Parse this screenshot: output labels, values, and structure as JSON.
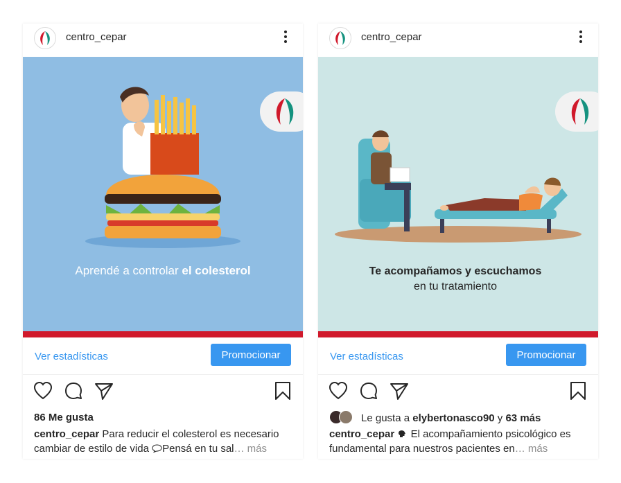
{
  "colors": {
    "accent_blue": "#3897f0",
    "brand_red": "#d0192b",
    "brand_teal": "#15927f",
    "text": "#262626",
    "muted": "#8e8e8e",
    "left_bg": "#8fbde3",
    "right_bg": "#cde6e6"
  },
  "posts": [
    {
      "username": "centro_cepar",
      "menu_icon": "more-vertical-icon",
      "image_text_line1_normal": "Aprendé a controlar ",
      "image_text_line1_bold": "el colesterol",
      "stats_link": "Ver estadísticas",
      "promote_button": "Promocionar",
      "likes_text": "86 Me gusta",
      "caption_user": "centro_cepar",
      "caption_text": "Para reducir el colesterol es necesario cambiar de estilo de vida ",
      "caption_text_2": "Pensá en tu sal",
      "caption_more": "… más",
      "action_icons": [
        "heart-icon",
        "comment-icon",
        "share-icon",
        "bookmark-icon"
      ]
    },
    {
      "username": "centro_cepar",
      "menu_icon": "more-vertical-icon",
      "image_text_line1": "Te acompañamos y escuchamos",
      "image_text_line2": "en tu tratamiento",
      "stats_link": "Ver estadísticas",
      "promote_button": "Promocionar",
      "likes_prefix": "Le gusta a ",
      "likes_user": "elybertonasco90",
      "likes_mid": " y ",
      "likes_count": "63 más",
      "caption_user": "centro_cepar",
      "caption_text": "El acompañamiento psicológico es fundamental para nuestros pacientes en",
      "caption_more": "… más",
      "action_icons": [
        "heart-icon",
        "comment-icon",
        "share-icon",
        "bookmark-icon"
      ]
    }
  ]
}
